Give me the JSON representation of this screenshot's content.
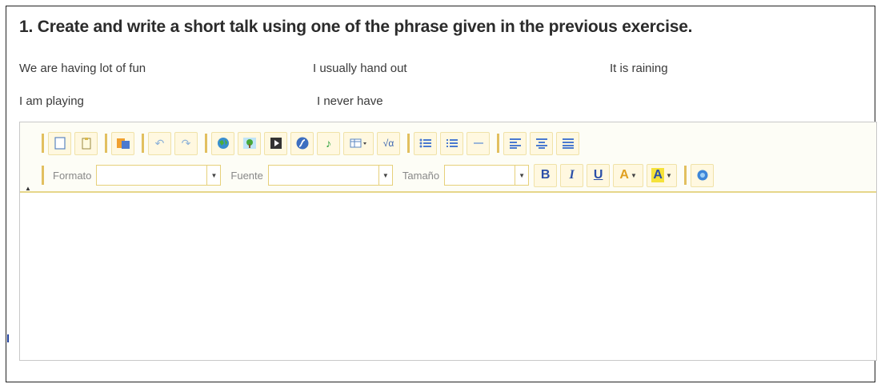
{
  "title": "1. Create and write a short talk using one of the phrase given in the previous exercise.",
  "phrases": [
    "We are having lot of fun",
    "I usually hand out",
    "It is raining",
    "I am playing",
    "I never have"
  ],
  "toolbar": {
    "format_label": "Formato",
    "font_label": "Fuente",
    "size_label": "Tamaño",
    "format_value": "",
    "font_value": "",
    "size_value": "",
    "bold_label": "B",
    "italic_label": "I",
    "underline_label": "U",
    "font_color_label": "A",
    "bg_color_label": "A"
  },
  "editor": {
    "content": ""
  },
  "colors": {
    "accent_border": "#e6d68a",
    "toolbar_bg": "#fdfdf6",
    "button_bg": "#fff8e0"
  }
}
